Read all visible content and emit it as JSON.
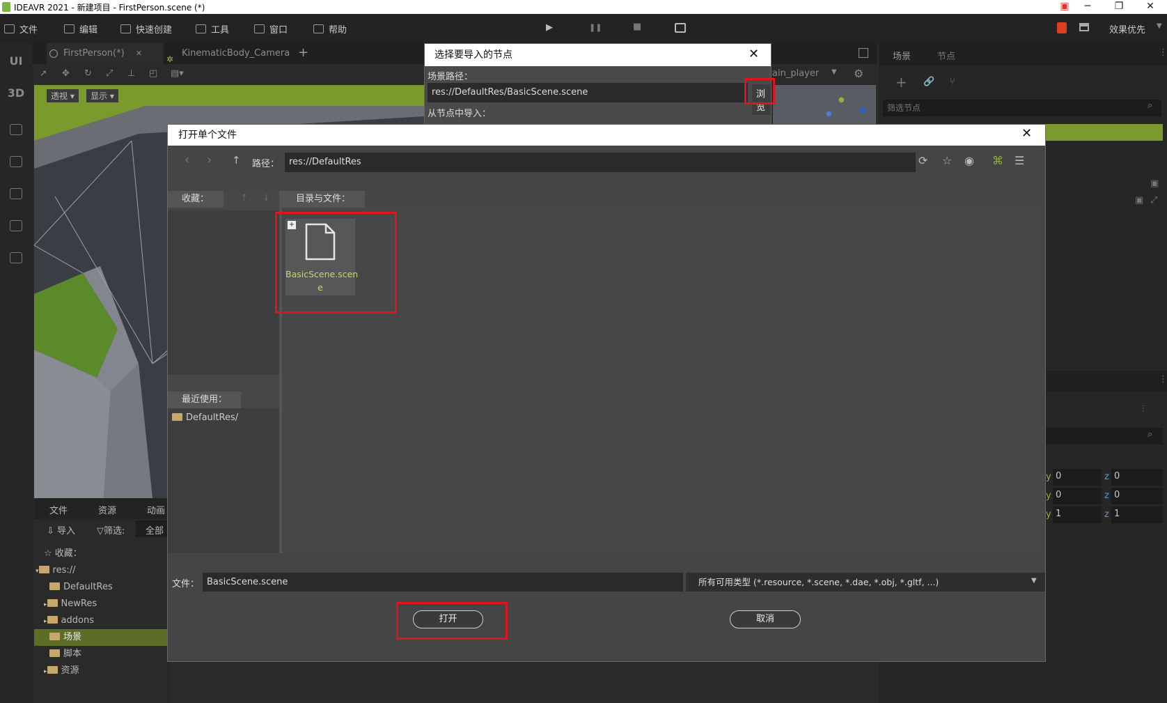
{
  "window": {
    "title": "IDEAVR 2021 - 新建项目 - FirstPerson.scene (*)",
    "min": "─",
    "restore": "❐",
    "close": "✕",
    "extra": "▣"
  },
  "menubar": {
    "items": [
      {
        "label": "文件",
        "icon": "folder-icon"
      },
      {
        "label": "编辑",
        "icon": "edit-icon"
      },
      {
        "label": "快速创建",
        "icon": "quick-create-icon"
      },
      {
        "label": "工具",
        "icon": "tools-icon"
      },
      {
        "label": "窗口",
        "icon": "window-icon"
      },
      {
        "label": "帮助",
        "icon": "help-icon"
      }
    ],
    "play": "▶",
    "pause": "❚❚",
    "stop": "■",
    "quality": "效果优先"
  },
  "left_toolbar": {
    "ui": "UI",
    "three_d": "3D"
  },
  "tabs": [
    {
      "label": "FirstPerson(*)",
      "close": "✕"
    },
    {
      "label": "KinematicBody_Camera"
    }
  ],
  "add_tab": "+",
  "viewport": {
    "perspective": "透视",
    "display": "显示",
    "camera_node": "ain_player"
  },
  "dock": {
    "tabs": [
      "文件",
      "资源",
      "动画"
    ],
    "import": "导入",
    "filter": "筛选:",
    "filter_all": "全部",
    "favorites": "收藏：",
    "tree": [
      {
        "label": "res://",
        "level": 0,
        "arrow": "▾"
      },
      {
        "label": "DefaultRes",
        "level": 1,
        "arrow": ""
      },
      {
        "label": "NewRes",
        "level": 1,
        "arrow": "▸"
      },
      {
        "label": "addons",
        "level": 1,
        "arrow": "▸"
      },
      {
        "label": "场景",
        "level": 1,
        "arrow": "",
        "selected": true
      },
      {
        "label": "脚本",
        "level": 1,
        "arrow": ""
      },
      {
        "label": "资源",
        "level": 1,
        "arrow": "▸"
      }
    ]
  },
  "right_panel": {
    "tabs": [
      "场景",
      "节点"
    ],
    "filter_placeholder": "筛选节点",
    "transform_rows": [
      {
        "y": "0",
        "z": "0"
      },
      {
        "y": "0",
        "z": "0"
      },
      {
        "y": "1",
        "z": "1"
      }
    ],
    "y_label": "y",
    "z_label": "z"
  },
  "modal_import": {
    "title": "选择要导入的节点",
    "scene_path_label": "场景路径：",
    "scene_path": "res://DefaultRes/BasicScene.scene",
    "browse": "浏览",
    "from_node_label": "从节点中导入："
  },
  "modal_open": {
    "title": "打开单个文件",
    "path_label": "路径：",
    "path": "res://DefaultRes",
    "favorites_label": "收藏：",
    "recent_label": "最近使用：",
    "recent_items": [
      "DefaultRes/"
    ],
    "dirs_files_label": "目录与文件：",
    "files": [
      {
        "name": "BasicScene.scen",
        "name2": "e"
      }
    ],
    "file_label": "文件：",
    "file_value": "BasicScene.scene",
    "filter_value": "所有可用类型 (*.resource, *.scene, *.dae, *.obj, *.gltf, ...)",
    "open": "打开",
    "cancel": "取消"
  },
  "colors": {
    "accent": "#8fb33a",
    "highlight_red": "#e0141e",
    "file_name": "#c9d46a"
  }
}
